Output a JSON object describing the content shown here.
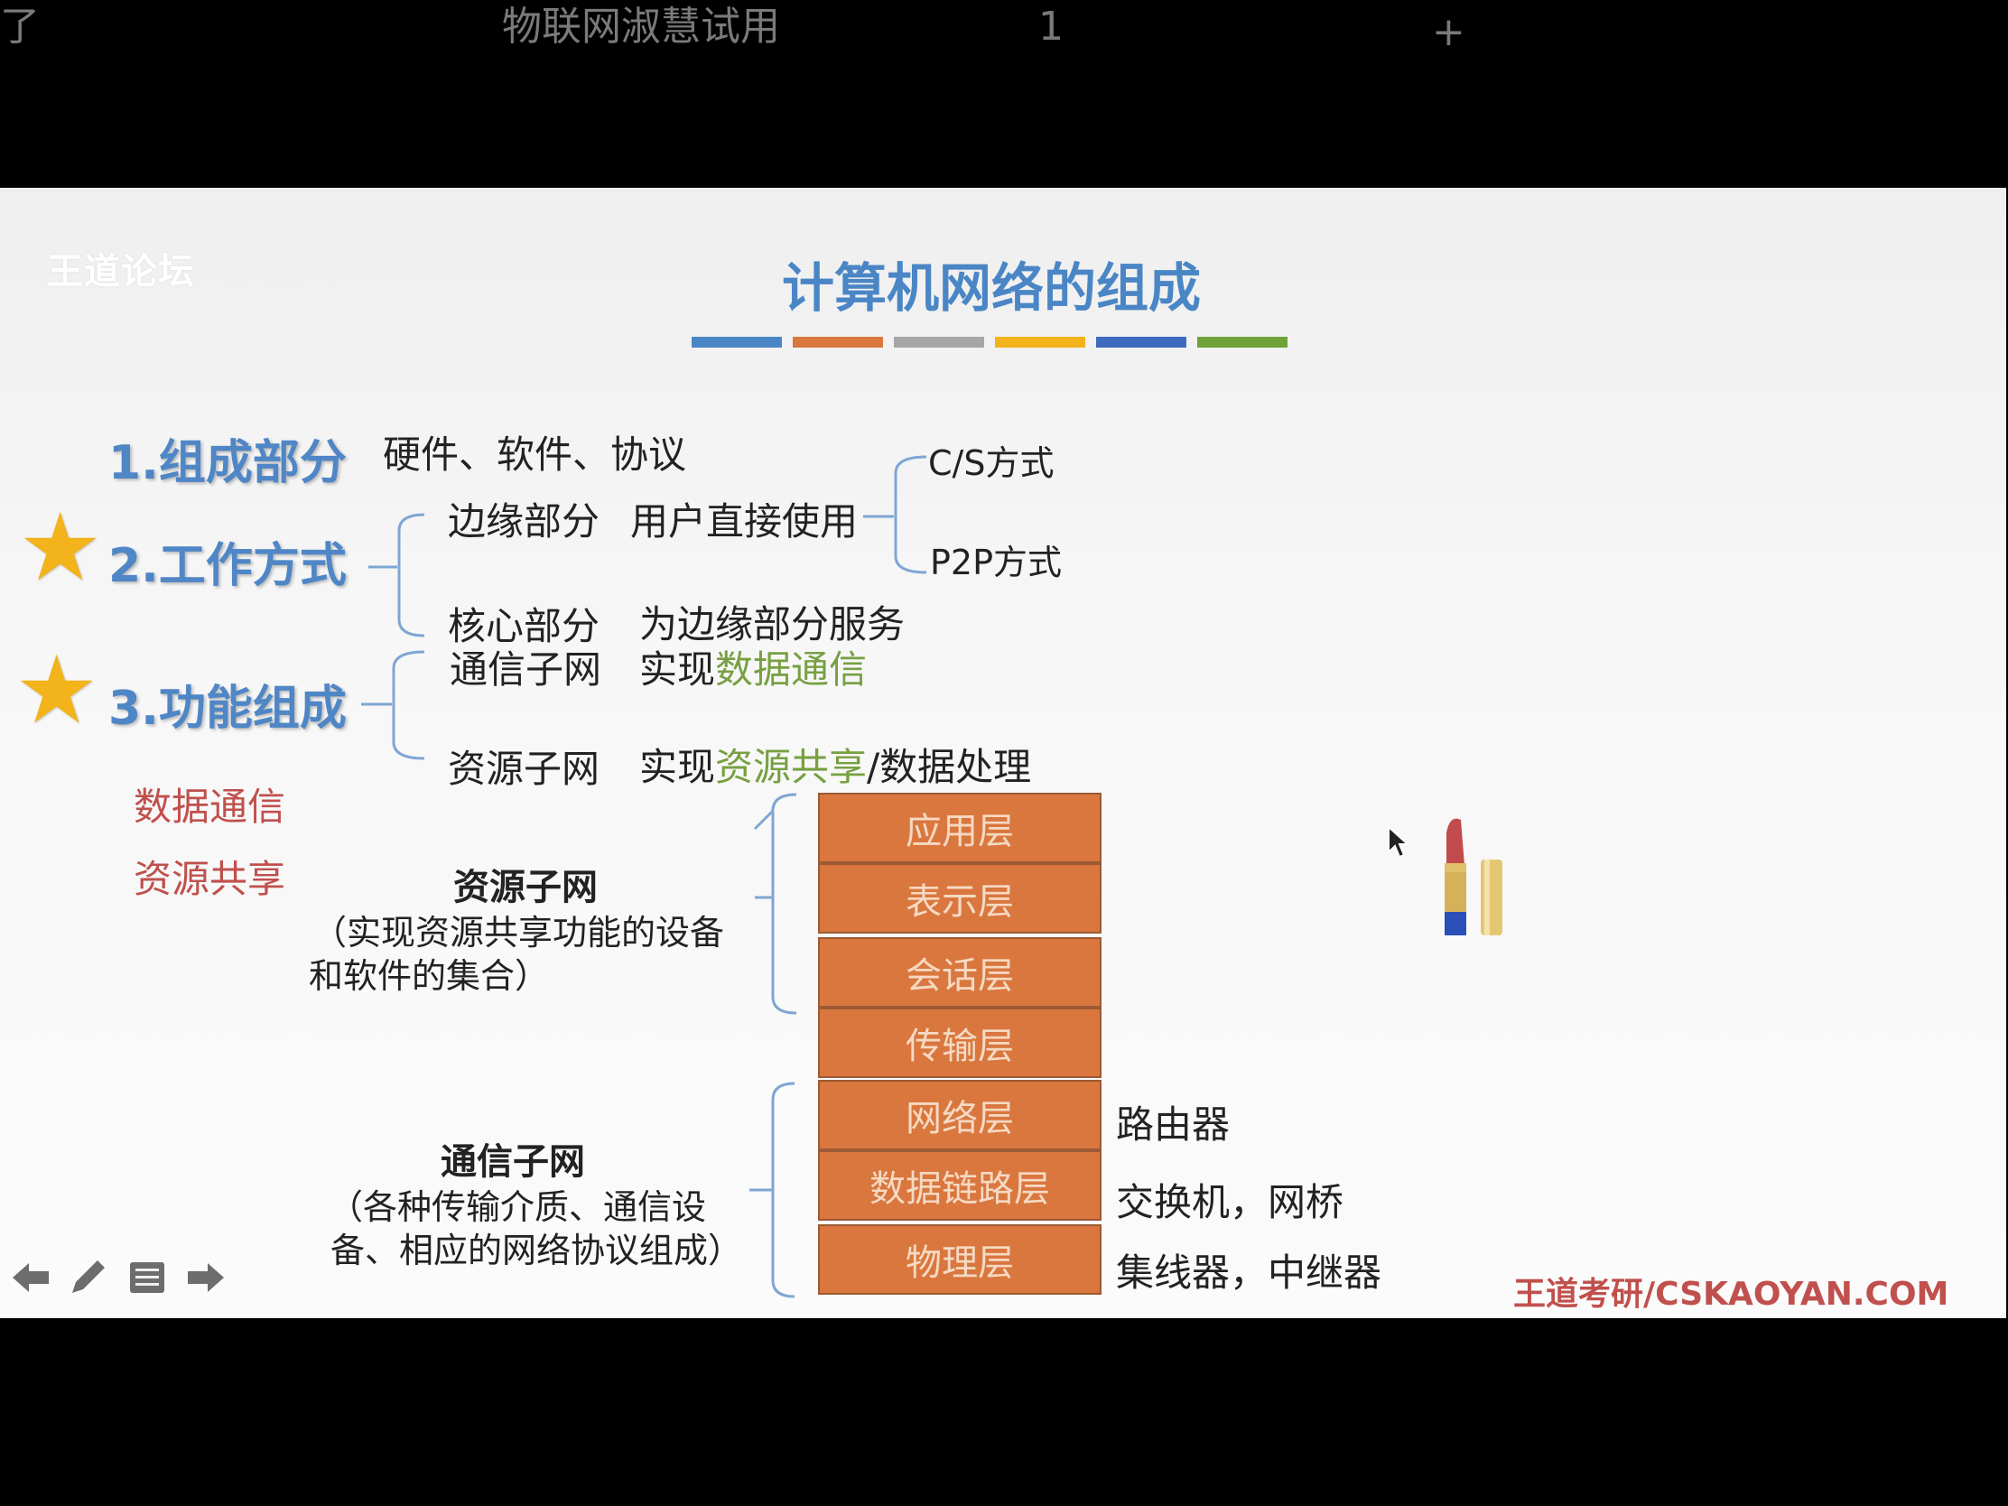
{
  "top_bar": {
    "left_char": "了",
    "doc_title": "物联网淑慧试用",
    "page_number": "1",
    "plus": "+"
  },
  "slide": {
    "watermark": "王道论坛",
    "watermark_script": "L雅书",
    "title": "计算机网络的组成",
    "title_bar_colors": [
      "#4a86c5",
      "#d9773e",
      "#a6a6a6",
      "#f2b31b",
      "#3f6bbf",
      "#6fa33a"
    ],
    "section1": {
      "heading": "1.组成部分",
      "content": "硬件、软件、协议"
    },
    "section2": {
      "heading": "2.工作方式",
      "edge_label": "边缘部分",
      "edge_desc": "用户直接使用",
      "cs_mode": "C/S方式",
      "p2p_mode": "P2P方式",
      "core_label": "核心部分",
      "core_desc": "为边缘部分服务"
    },
    "section3": {
      "heading": "3.功能组成",
      "comm_label": "通信子网",
      "comm_desc_prefix": "实现",
      "comm_desc_highlight": "数据通信",
      "res_label": "资源子网",
      "res_desc_prefix": "实现",
      "res_desc_highlight": "资源共享",
      "res_desc_suffix": "/数据处理"
    },
    "red_notes": [
      "数据通信",
      "资源共享"
    ],
    "resource_subnet": {
      "title": "资源子网",
      "desc_line1": "（实现资源共享功能的设备",
      "desc_line2": "和软件的集合）"
    },
    "comm_subnet": {
      "title": "通信子网",
      "desc_line1": "（各种传输介质、通信设",
      "desc_line2": "备、相应的网络协议组成）"
    },
    "layers": [
      "应用层",
      "表示层",
      "会话层",
      "传输层",
      "网络层",
      "数据链路层",
      "物理层"
    ],
    "devices": {
      "network": "路由器",
      "datalink": "交换机，网桥",
      "physical": "集线器，中继器"
    },
    "brand": "王道考研/CSKAOYAN.COM",
    "nav_icons": [
      "arrow-left-icon",
      "pencil-icon",
      "menu-icon",
      "arrow-right-icon"
    ]
  }
}
